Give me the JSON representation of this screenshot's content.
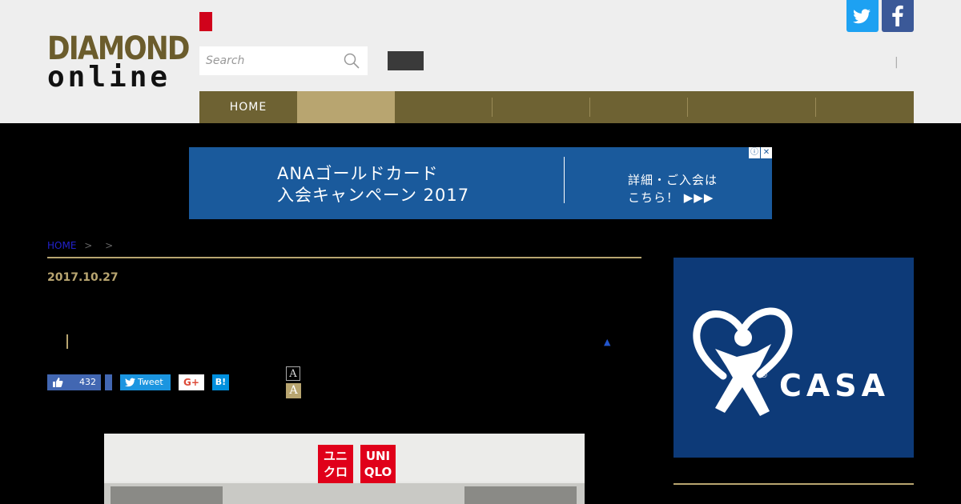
{
  "header": {
    "logo": {
      "line1": "DIAMOND",
      "line2": "online"
    },
    "search": {
      "placeholder": "Search"
    },
    "separator": "|"
  },
  "nav": {
    "items": [
      {
        "label": "HOME"
      },
      {
        "label": ""
      },
      {
        "label": ""
      },
      {
        "label": ""
      },
      {
        "label": ""
      },
      {
        "label": ""
      },
      {
        "label": ""
      }
    ]
  },
  "banner": {
    "line1": "ANAゴールドカード",
    "line2": "入会キャンペーン 2017",
    "cta1": "詳細・ご入会は",
    "cta2": "こちら！ ▶▶▶"
  },
  "breadcrumb": {
    "home": "HOME",
    "sep1": ">",
    "sep2": ">"
  },
  "article": {
    "date": "2017.10.27",
    "toggle": "▲"
  },
  "share": {
    "like_count": "432",
    "tweet_label": "Tweet",
    "gplus_label": "G+",
    "hatena_label": "B!"
  },
  "font_size": {
    "small": "A",
    "large": "A"
  },
  "photo": {
    "sign_left": "ユニクロ",
    "sign_right": "UNI QLO"
  },
  "side_ad": {
    "brand": "CASA",
    "registered": "®"
  },
  "colors": {
    "header_bg": "#eeeeee",
    "logo_gold": "#6b5c2c",
    "nav_bg": "#6e6233",
    "accent_gold": "#b8a570",
    "banner_blue": "#1a5a9c",
    "side_ad_blue": "#0d3a78",
    "twitter_blue": "#1da1f2",
    "facebook_blue": "#3b5998"
  }
}
